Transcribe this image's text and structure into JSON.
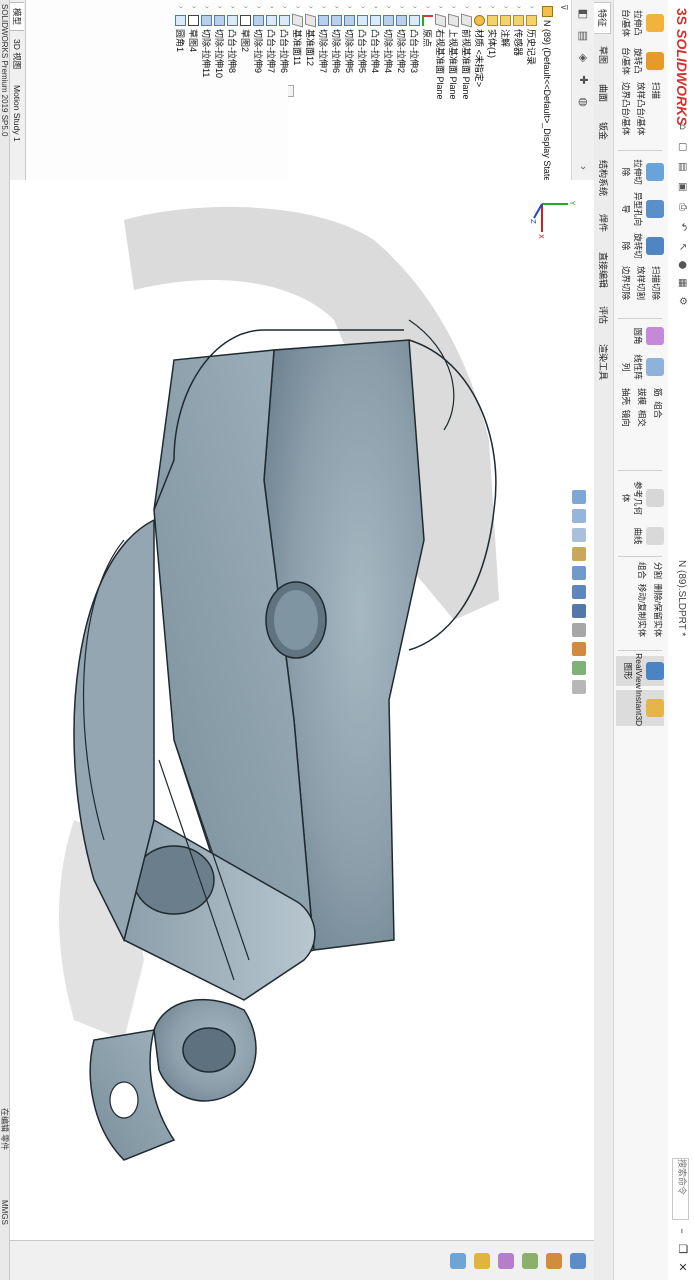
{
  "app": {
    "brand": "SOLIDWORKS",
    "document_title": "N (89).SLDPRT *",
    "search_placeholder": "搜索命令",
    "version_status": "SOLIDWORKS Premium 2019 SP5.0",
    "units": "MMGS",
    "edit_status": "在编辑 零件"
  },
  "ribbon": {
    "large_buttons": [
      {
        "label": "拉伸凸台/基体",
        "icon": "extrude-boss-icon"
      },
      {
        "label": "旋转凸台/基体",
        "icon": "revolve-boss-icon"
      },
      {
        "label": "拉伸切除",
        "icon": "extrude-cut-icon"
      },
      {
        "label": "异型孔向导",
        "icon": "hole-wizard-icon"
      },
      {
        "label": "旋转切除",
        "icon": "revolve-cut-icon"
      },
      {
        "label": "圆角",
        "icon": "fillet-icon"
      },
      {
        "label": "线性阵列",
        "icon": "linear-pattern-icon"
      },
      {
        "label": "筋",
        "icon": "rib-icon"
      },
      {
        "label": "拔模",
        "icon": "draft-icon"
      },
      {
        "label": "抽壳",
        "icon": "shell-icon"
      },
      {
        "label": "包覆",
        "icon": "wrap-icon"
      },
      {
        "label": "相交",
        "icon": "intersect-icon"
      },
      {
        "label": "参考几何体",
        "icon": "reference-geometry-icon"
      },
      {
        "label": "曲线",
        "icon": "curves-icon"
      },
      {
        "label": "Instant3D",
        "icon": "instant3d-icon"
      },
      {
        "label": "RealView 图形",
        "icon": "realview-icon"
      }
    ],
    "small_buttons": [
      {
        "label": "扫描",
        "icon": "sweep-icon"
      },
      {
        "label": "放样凸台/基体",
        "icon": "loft-boss-icon"
      },
      {
        "label": "边界凸台/基体",
        "icon": "boundary-boss-icon"
      },
      {
        "label": "扫描切除",
        "icon": "swept-cut-icon"
      },
      {
        "label": "放样切割",
        "icon": "lofted-cut-icon"
      },
      {
        "label": "边界切除",
        "icon": "boundary-cut-icon"
      },
      {
        "label": "镜向",
        "icon": "mirror-icon"
      },
      {
        "label": "分割",
        "icon": "split-icon"
      },
      {
        "label": "组合",
        "icon": "combine-icon"
      },
      {
        "label": "删除/保留实体",
        "icon": "delete-keep-body-icon"
      },
      {
        "label": "移动/复制实体",
        "icon": "move-copy-body-icon"
      }
    ]
  },
  "command_tabs": [
    {
      "label": "特征",
      "active": true
    },
    {
      "label": "草图",
      "active": false
    },
    {
      "label": "曲面",
      "active": false
    },
    {
      "label": "钣金",
      "active": false
    },
    {
      "label": "结构系统",
      "active": false
    },
    {
      "label": "焊件",
      "active": false
    },
    {
      "label": "直接编辑",
      "active": false
    },
    {
      "label": "评估",
      "active": false
    },
    {
      "label": "渲染工具",
      "active": false
    }
  ],
  "feature_tree": {
    "root": "N (89)  (Default<<Default>_Display State",
    "items": [
      {
        "label": "历史记录",
        "type": "folder"
      },
      {
        "label": "传感器",
        "type": "folder"
      },
      {
        "label": "注解",
        "type": "folder"
      },
      {
        "label": "实体(1)",
        "type": "folder"
      },
      {
        "label": "材质 <未指定>",
        "type": "material"
      },
      {
        "label": "前视基准面 Plane",
        "type": "plane"
      },
      {
        "label": "上视基准面 Plane",
        "type": "plane"
      },
      {
        "label": "右视基准面 Plane",
        "type": "plane"
      },
      {
        "label": "原点",
        "type": "origin"
      },
      {
        "label": "凸台-拉伸3",
        "type": "feature"
      },
      {
        "label": "切除-拉伸2",
        "type": "cut"
      },
      {
        "label": "切除-拉伸4",
        "type": "cut"
      },
      {
        "label": "凸台-拉伸4",
        "type": "feature"
      },
      {
        "label": "凸台-拉伸5",
        "type": "feature"
      },
      {
        "label": "切除-拉伸5",
        "type": "cut"
      },
      {
        "label": "切除-拉伸6",
        "type": "cut"
      },
      {
        "label": "切除-拉伸7",
        "type": "cut"
      },
      {
        "label": "基准面12",
        "type": "plane"
      },
      {
        "label": "基准面11",
        "type": "plane"
      },
      {
        "label": "凸台-拉伸6",
        "type": "feature"
      },
      {
        "label": "凸台-拉伸7",
        "type": "feature"
      },
      {
        "label": "切除-拉伸9",
        "type": "cut"
      },
      {
        "label": "草图2",
        "type": "sketch"
      },
      {
        "label": "凸台-拉伸8",
        "type": "feature"
      },
      {
        "label": "切除-拉伸10",
        "type": "cut"
      },
      {
        "label": "切除-拉伸11",
        "type": "cut"
      },
      {
        "label": "草图4",
        "type": "sketch"
      },
      {
        "label": "圆角1",
        "type": "feature"
      }
    ]
  },
  "bottom_tabs": [
    {
      "label": "模型",
      "active": true
    },
    {
      "label": "3D 视图",
      "active": false
    },
    {
      "label": "Motion Study 1",
      "active": false
    }
  ],
  "triad": {
    "x_label": "X",
    "y_label": "Y",
    "z_label": "Z"
  },
  "colors": {
    "brand_red": "#d4332a",
    "part_steel": "#8ea1ad",
    "selection_blue": "#2f7fd6"
  }
}
